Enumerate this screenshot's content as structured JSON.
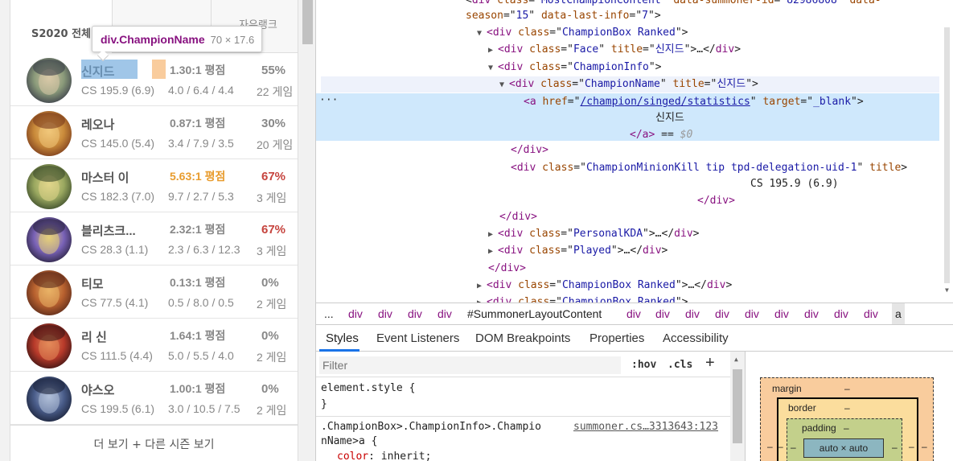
{
  "page": {
    "tabs": [
      {
        "label": "S2020 전체"
      },
      {
        "label": ""
      },
      {
        "label": "자유랭크"
      }
    ],
    "tooltip": {
      "element": "div.ChampionName",
      "size": "70 × 17.6"
    },
    "champions": [
      {
        "name": "신지드",
        "ratio": "1.30:1 평점",
        "cs": "CS 195.9 (6.9)",
        "kda": "4.0 / 6.4 / 4.4",
        "winrate": "55%",
        "games": "22 게임",
        "avatar": "singed-portrait"
      },
      {
        "name": "레오나",
        "ratio": "0.87:1 평점",
        "cs": "CS 145.0 (5.4)",
        "kda": "3.4 / 7.9 / 3.5",
        "winrate": "30%",
        "games": "20 게임",
        "avatar": "leona-portrait"
      },
      {
        "name": "마스터 이",
        "ratio": "5.63:1 평점",
        "cs": "CS 182.3 (7.0)",
        "kda": "9.7 / 2.7 / 5.3",
        "winrate": "67%",
        "games": "3 게임",
        "avatar": "masteryi-portrait"
      },
      {
        "name": "블리츠크...",
        "ratio": "2.32:1 평점",
        "cs": "CS 28.3 (1.1)",
        "kda": "2.3 / 6.3 / 12.3",
        "winrate": "67%",
        "games": "3 게임",
        "avatar": "blitzcrank-portrait"
      },
      {
        "name": "티모",
        "ratio": "0.13:1 평점",
        "cs": "CS 77.5 (4.1)",
        "kda": "0.5 / 8.0 / 0.5",
        "winrate": "0%",
        "games": "2 게임",
        "avatar": "teemo-portrait"
      },
      {
        "name": "리 신",
        "ratio": "1.64:1 평점",
        "cs": "CS 111.5 (4.4)",
        "kda": "5.0 / 5.5 / 4.0",
        "winrate": "0%",
        "games": "2 게임",
        "avatar": "leesin-portrait"
      },
      {
        "name": "야스오",
        "ratio": "1.00:1 평점",
        "cs": "CS 199.5 (6.1)",
        "kda": "3.0 / 10.5 / 7.5",
        "winrate": "0%",
        "games": "2 게임",
        "avatar": "yasuo-portrait"
      }
    ],
    "more_label": "더 보기 + 다른 시즌 보기"
  },
  "devtools": {
    "lines": [
      {
        "parts": [
          [
            "plain",
            "<"
          ],
          [
            "tag",
            "div "
          ],
          [
            "attr",
            "class"
          ],
          [
            "plain",
            "=\""
          ],
          [
            "val",
            "MostChampionContent"
          ],
          [
            "plain",
            "\" "
          ],
          [
            "attr",
            "data-summoner-id"
          ],
          [
            "plain",
            "=\""
          ],
          [
            "val",
            "82986808"
          ],
          [
            "plain",
            "\" "
          ],
          [
            "attr",
            "data-"
          ]
        ]
      },
      {
        "parts": [
          [
            "attr",
            "season"
          ],
          [
            "plain",
            "=\""
          ],
          [
            "val",
            "15"
          ],
          [
            "plain",
            "\" "
          ],
          [
            "attr",
            "data-last-info"
          ],
          [
            "plain",
            "=\""
          ],
          [
            "val",
            "7"
          ],
          [
            "plain",
            "\">"
          ]
        ]
      },
      {
        "parts": [
          [
            "tri",
            "▼"
          ],
          [
            "tag",
            "<div "
          ],
          [
            "attr",
            "class"
          ],
          [
            "plain",
            "=\""
          ],
          [
            "val",
            "ChampionBox Ranked"
          ],
          [
            "plain",
            "\">"
          ]
        ]
      },
      {
        "parts": [
          [
            "tri",
            "▶"
          ],
          [
            "tag",
            "<div "
          ],
          [
            "attr",
            "class"
          ],
          [
            "plain",
            "=\""
          ],
          [
            "val",
            "Face"
          ],
          [
            "plain",
            "\" "
          ],
          [
            "attr",
            "title"
          ],
          [
            "plain",
            "=\""
          ],
          [
            "val",
            "신지드"
          ],
          [
            "plain",
            "\">…</"
          ],
          [
            "tag",
            "div"
          ],
          [
            "plain",
            ">"
          ]
        ]
      },
      {
        "parts": [
          [
            "tri",
            "▼"
          ],
          [
            "tag",
            "<div "
          ],
          [
            "attr",
            "class"
          ],
          [
            "plain",
            "=\""
          ],
          [
            "val",
            "ChampionInfo"
          ],
          [
            "plain",
            "\">"
          ]
        ]
      },
      {
        "parts": [
          [
            "tri",
            "▼"
          ],
          [
            "tag",
            "<div "
          ],
          [
            "attr",
            "class"
          ],
          [
            "plain",
            "=\""
          ],
          [
            "val",
            "ChampionName"
          ],
          [
            "plain",
            "\" "
          ],
          [
            "attr",
            "title"
          ],
          [
            "plain",
            "=\""
          ],
          [
            "val",
            "신지드"
          ],
          [
            "plain",
            "\">"
          ]
        ]
      },
      {
        "parts": [
          [
            "tag",
            "<a "
          ],
          [
            "attr",
            "href"
          ],
          [
            "plain",
            "=\""
          ],
          [
            "link",
            "/champion/singed/statistics"
          ],
          [
            "plain",
            "\" "
          ],
          [
            "attr",
            "target"
          ],
          [
            "plain",
            "=\""
          ],
          [
            "val",
            "_blank"
          ],
          [
            "plain",
            "\">"
          ]
        ]
      },
      {
        "parts": [
          [
            "plain",
            "신지드"
          ]
        ]
      },
      {
        "parts": [
          [
            "tag",
            "</a>"
          ],
          [
            "plain",
            " == "
          ],
          [
            "gray",
            "$0"
          ]
        ]
      },
      {
        "parts": [
          [
            "tag",
            "</div>"
          ]
        ]
      },
      {
        "parts": [
          [
            "tag",
            "<div "
          ],
          [
            "attr",
            "class"
          ],
          [
            "plain",
            "=\""
          ],
          [
            "val",
            "ChampionMinionKill tip tpd-delegation-uid-1"
          ],
          [
            "plain",
            "\" "
          ],
          [
            "attr",
            "title"
          ],
          [
            "plain",
            ">"
          ]
        ]
      },
      {
        "parts": [
          [
            "plain",
            "CS 195.9 (6.9)"
          ]
        ]
      },
      {
        "parts": [
          [
            "tag",
            "</div>"
          ]
        ]
      },
      {
        "parts": [
          [
            "tag",
            "</div>"
          ]
        ]
      },
      {
        "parts": [
          [
            "tri",
            "▶"
          ],
          [
            "tag",
            "<div "
          ],
          [
            "attr",
            "class"
          ],
          [
            "plain",
            "=\""
          ],
          [
            "val",
            "PersonalKDA"
          ],
          [
            "plain",
            "\">…</"
          ],
          [
            "tag",
            "div"
          ],
          [
            "plain",
            ">"
          ]
        ]
      },
      {
        "parts": [
          [
            "tri",
            "▶"
          ],
          [
            "tag",
            "<div "
          ],
          [
            "attr",
            "class"
          ],
          [
            "plain",
            "=\""
          ],
          [
            "val",
            "Played"
          ],
          [
            "plain",
            "\">…</"
          ],
          [
            "tag",
            "div"
          ],
          [
            "plain",
            ">"
          ]
        ]
      },
      {
        "parts": [
          [
            "tag",
            "</div>"
          ]
        ]
      },
      {
        "parts": [
          [
            "tri",
            "▶"
          ],
          [
            "tag",
            "<div "
          ],
          [
            "attr",
            "class"
          ],
          [
            "plain",
            "=\""
          ],
          [
            "val",
            "ChampionBox Ranked"
          ],
          [
            "plain",
            "\">…</"
          ],
          [
            "tag",
            "div"
          ],
          [
            "plain",
            ">"
          ]
        ]
      },
      {
        "parts": [
          [
            "tri",
            "▶"
          ],
          [
            "tag",
            "<div "
          ],
          [
            "attr",
            "class"
          ],
          [
            "plain",
            "=\""
          ],
          [
            "val",
            "ChampionBox Ranked"
          ],
          [
            "plain",
            "\">"
          ]
        ]
      }
    ],
    "dots": "···",
    "breadcrumbs": [
      "...",
      "div",
      "div",
      "div",
      "div",
      "#SummonerLayoutContent",
      "div",
      "div",
      "div",
      "div",
      "div",
      "div",
      "div",
      "div",
      "div",
      "a"
    ],
    "subtabs": [
      "Styles",
      "Event Listeners",
      "DOM Breakpoints",
      "Properties",
      "Accessibility"
    ],
    "styles": {
      "filter_placeholder": "Filter",
      "hov": ":hov",
      "cls": ".cls",
      "plus": "+",
      "element_style_open": "element.style {",
      "element_style_close": "}",
      "rule_selector_1": ".ChampionBox>.ChampionInfo>.Champio",
      "rule_selector_2": "nName>a {",
      "rule_source": "summoner.cs…3313643:123",
      "rule_prop": "color",
      "rule_value": "inherit;"
    },
    "boxmodel": {
      "margin_label": "margin",
      "margin_value": "–",
      "border_label": "border",
      "border_value": "–",
      "padding_label": "padding",
      "padding_value": "–",
      "content": "auto × auto",
      "side": "–"
    },
    "colors": {
      "tag": "#881280",
      "attr": "#994500",
      "value": "#1a1aa6",
      "selected_row": "#cfe8fc",
      "winrate_red": "#c6443e",
      "ratio_gold": "#e89c2e"
    }
  }
}
